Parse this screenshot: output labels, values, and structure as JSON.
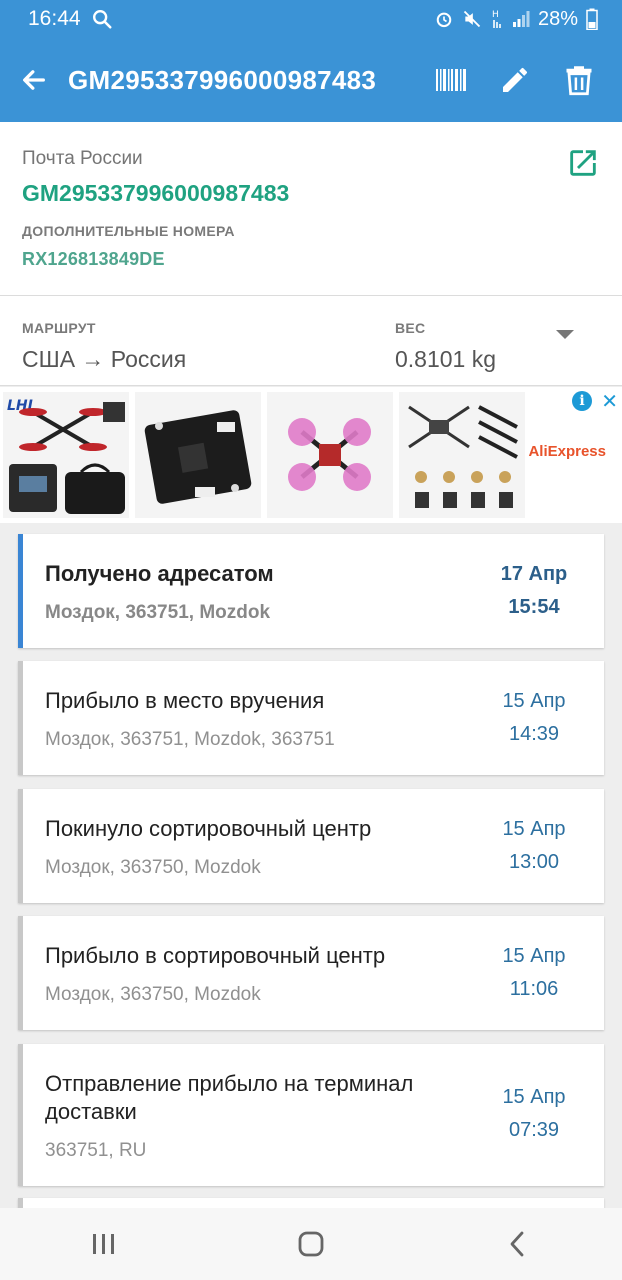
{
  "status": {
    "time": "16:44",
    "battery": "28%"
  },
  "appbar": {
    "title": "GM295337996000987483"
  },
  "parcel": {
    "carrier": "Почта России",
    "tracking_number": "GM295337996000987483",
    "extra_label": "ДОПОЛНИТЕЛЬНЫЕ НОМЕРА",
    "extra_number": "RX126813849DE"
  },
  "route": {
    "label": "МАРШРУТ",
    "value": "США → Россия",
    "weight_label": "ВЕС",
    "weight_value": "0.8101 kg"
  },
  "ad": {
    "brand": "AliExpress"
  },
  "events": [
    {
      "title": "Получено адресатом",
      "location": "Моздок, 363751, Mozdok",
      "date": "17 Апр",
      "time": "15:54"
    },
    {
      "title": "Прибыло в место вручения",
      "location": "Моздок, 363751, Mozdok, 363751",
      "date": "15 Апр",
      "time": "14:39"
    },
    {
      "title": "Покинуло сортировочный центр",
      "location": "Моздок, 363750, Mozdok",
      "date": "15 Апр",
      "time": "13:00"
    },
    {
      "title": "Прибыло в сортировочный центр",
      "location": "Моздок, 363750, Mozdok",
      "date": "15 Апр",
      "time": "11:06"
    },
    {
      "title": "Отправление прибыло на терминал доставки",
      "location": "363751, RU",
      "date": "15 Апр",
      "time": "07:39"
    }
  ],
  "colors": {
    "primary": "#3b93d6",
    "accent_green": "#1fa281",
    "date_blue": "#2c6f9f",
    "active_border": "#3a85d4"
  }
}
